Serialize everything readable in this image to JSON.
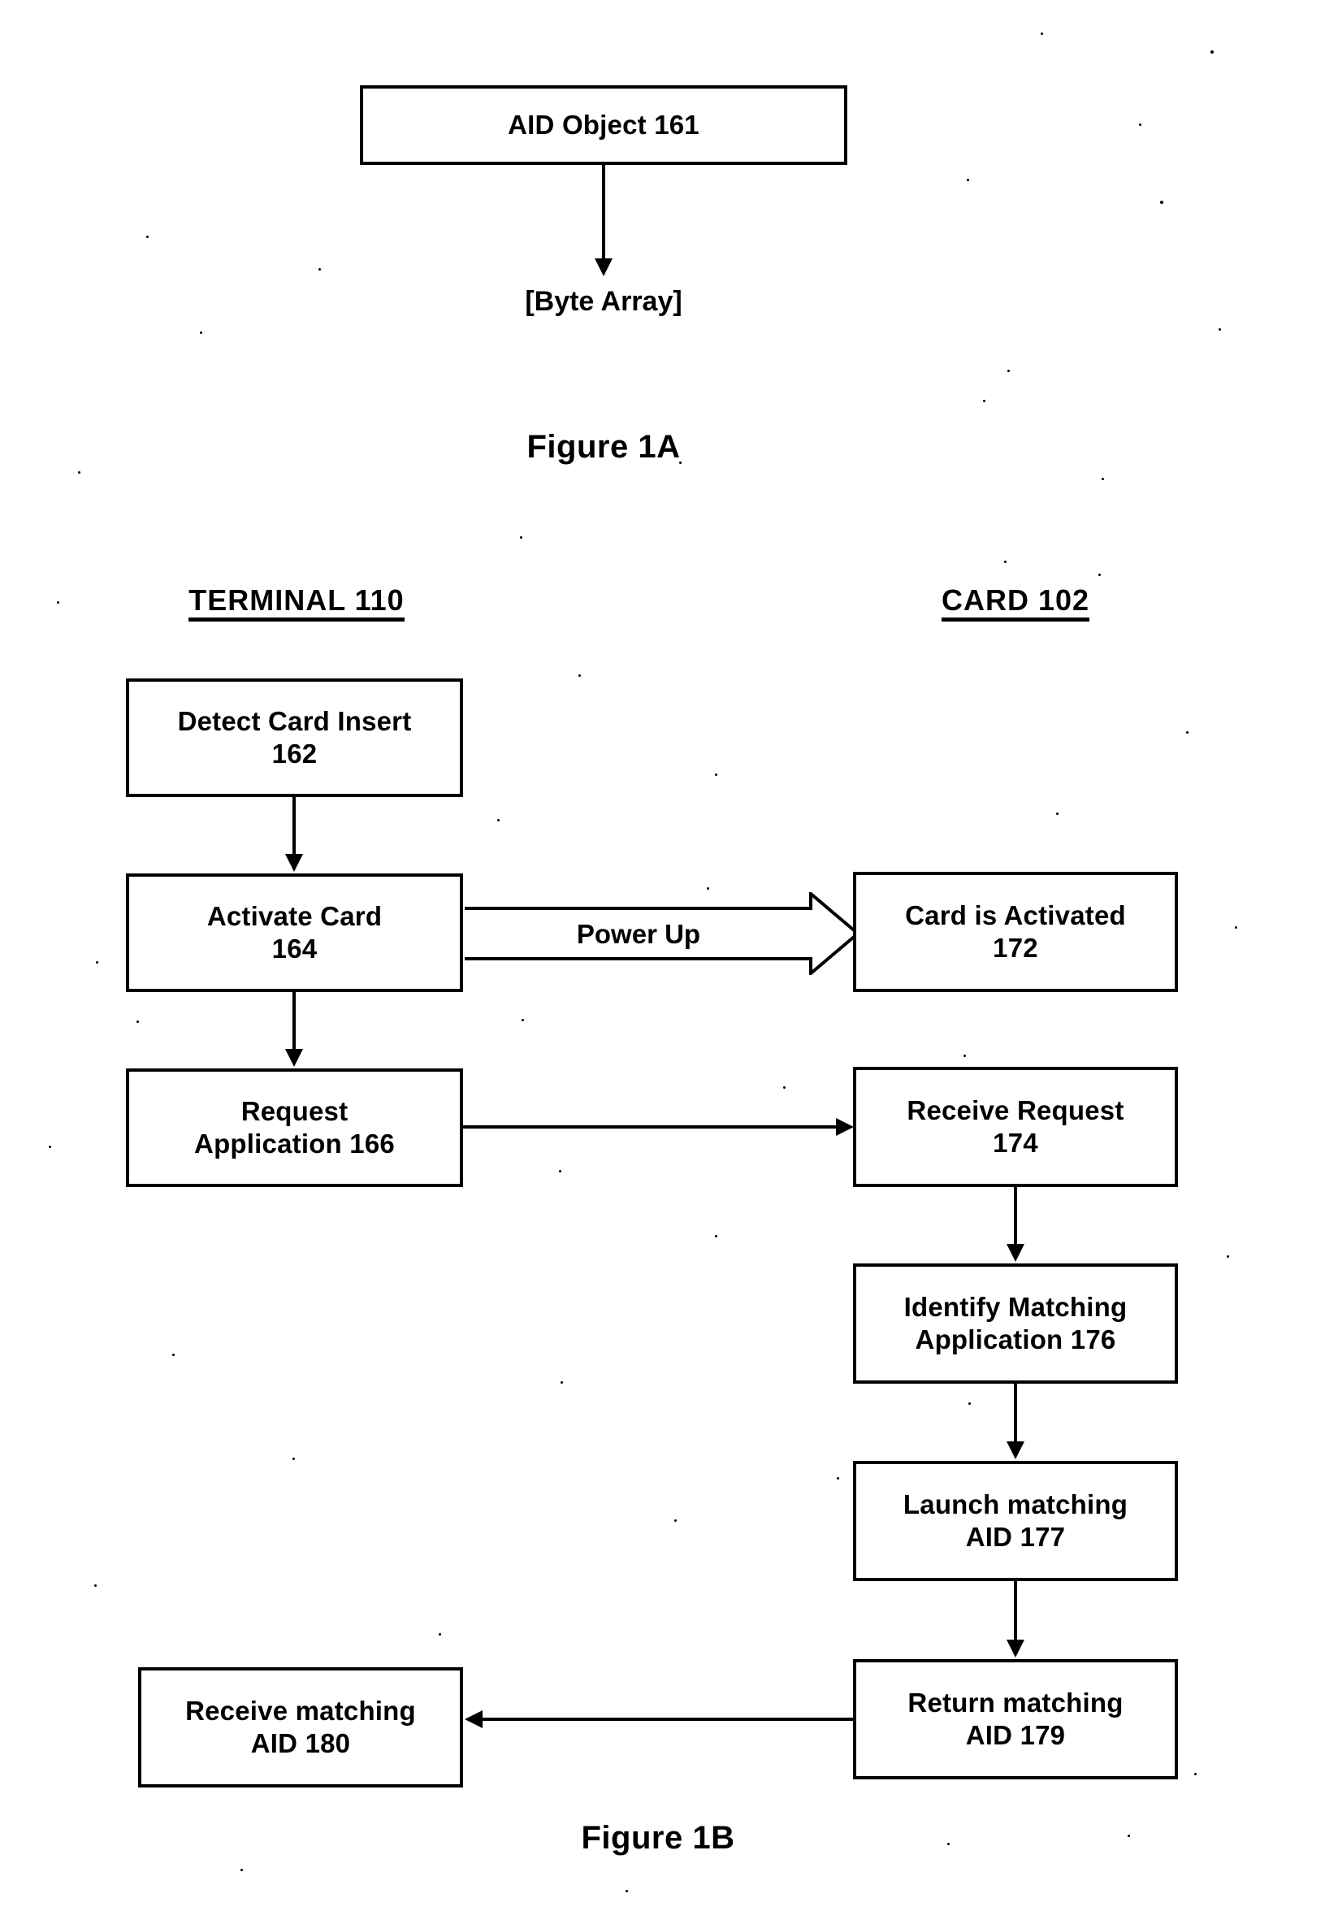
{
  "document": {
    "type": "patent-flow-diagram",
    "figures": [
      "Figure 1A",
      "Figure 1B"
    ]
  },
  "figure_1a": {
    "title": "Figure 1A",
    "box": {
      "label": "AID Object 161"
    },
    "arrow_label": "[Byte Array]"
  },
  "figure_1b": {
    "title": "Figure 1B",
    "columns": [
      {
        "id": "terminal",
        "header": "TERMINAL 110"
      },
      {
        "id": "card",
        "header": "CARD 102"
      }
    ],
    "terminal_steps": [
      {
        "id": "162",
        "line1": "Detect Card Insert",
        "line2": "162"
      },
      {
        "id": "164",
        "line1": "Activate Card",
        "line2": "164"
      },
      {
        "id": "166",
        "line1": "Request",
        "line2": "Application 166"
      },
      {
        "id": "180",
        "line1": "Receive matching",
        "line2": "AID 180"
      }
    ],
    "card_steps": [
      {
        "id": "172",
        "line1": "Card is Activated",
        "line2": "172"
      },
      {
        "id": "174",
        "line1": "Receive Request",
        "line2": "174"
      },
      {
        "id": "176",
        "line1": "Identify Matching",
        "line2": "Application 176"
      },
      {
        "id": "177",
        "line1": "Launch matching",
        "line2": "AID 177"
      },
      {
        "id": "179",
        "line1": "Return matching",
        "line2": "AID 179"
      }
    ],
    "connector_labels": [
      {
        "id": "power-up",
        "text": "Power Up"
      }
    ]
  },
  "colors": {
    "ink": "#000000",
    "paper": "#ffffff"
  }
}
